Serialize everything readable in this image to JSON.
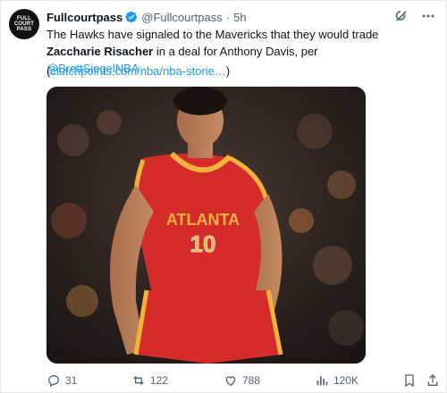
{
  "tweet": {
    "avatar_lines": [
      "FULL",
      "COURT",
      "PASS"
    ],
    "author_name": "Fullcourtpass",
    "verified": true,
    "handle": "@Fullcourtpass",
    "separator": "·",
    "time": "5h",
    "text_part1": "The Hawks have signaled to the Mavericks that they would trade ",
    "text_bold": "Zaccharie Risacher",
    "text_part2": " in a deal for Anthony Davis, per ",
    "mention": "@BrettSiegelNBA",
    "url_open": "(",
    "url": "clutchpoints.com/nba/nba-storie…",
    "url_close": ")",
    "jersey_text": "ATLANTA",
    "jersey_number": "10"
  },
  "actions": {
    "replies": "31",
    "reposts": "122",
    "likes": "788",
    "views": "120K"
  },
  "colors": {
    "link": "#1d9bf0",
    "muted": "#536471",
    "jersey_red": "#d62b2b",
    "jersey_gold": "#f2b23c"
  },
  "icons": [
    "verified-badge-icon",
    "grok-icon",
    "more-icon",
    "reply-icon",
    "repost-icon",
    "like-icon",
    "views-icon",
    "bookmark-icon",
    "share-icon"
  ]
}
